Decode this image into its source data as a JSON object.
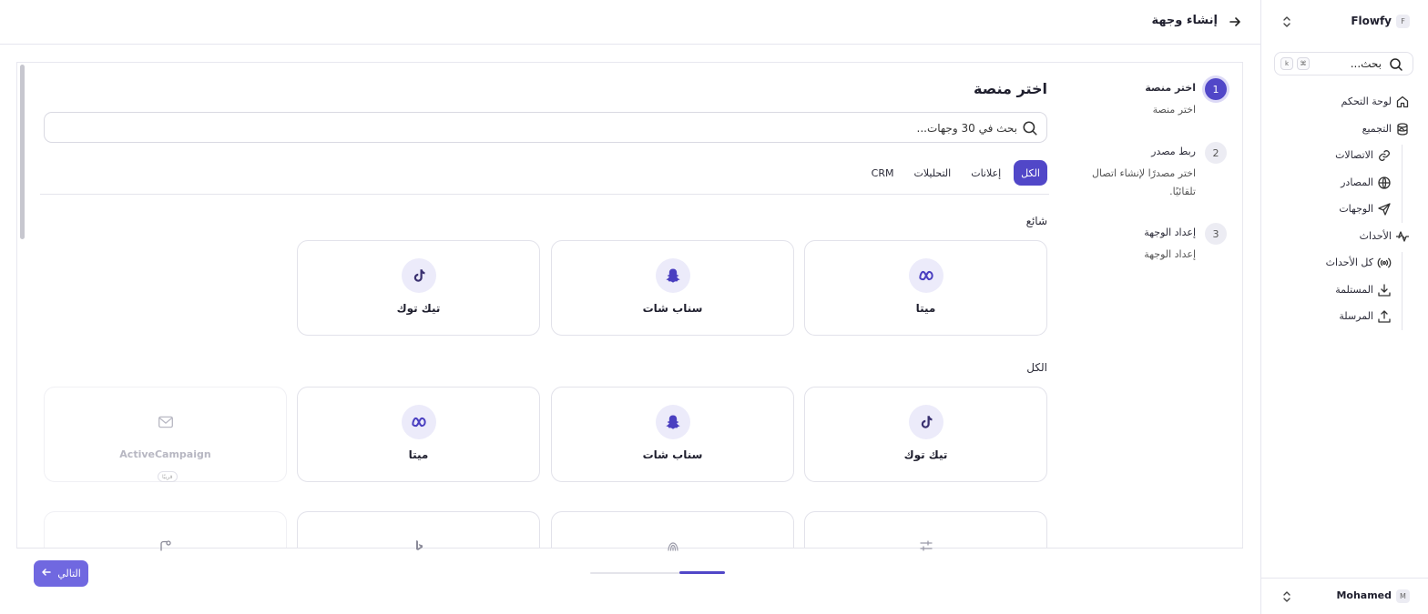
{
  "colors": {
    "accent": "#5147c8",
    "accent_soft": "#ecebfa",
    "next_button": "#7068e0"
  },
  "sidebar": {
    "workspace_name": "Flowfy",
    "workspace_badge": "F",
    "search_label": "بحث...",
    "shortcut_keys": [
      "⌘",
      "k"
    ],
    "items": [
      {
        "label": "لوحة التحكم",
        "icon": "home-icon"
      },
      {
        "label": "التجميع",
        "icon": "database-icon"
      },
      {
        "label": "الاتصالات",
        "icon": "link-icon"
      },
      {
        "label": "المصادر",
        "icon": "globe-icon"
      },
      {
        "label": "الوجهات",
        "icon": "send-icon"
      },
      {
        "label": "الأحداث",
        "icon": "activity-icon"
      },
      {
        "label": "كل الأحداث",
        "icon": "broadcast-icon"
      },
      {
        "label": "المستلمة",
        "icon": "download-icon"
      },
      {
        "label": "المرسلة",
        "icon": "upload-icon"
      }
    ],
    "user_name": "Mohamed",
    "user_badge": "M"
  },
  "header": {
    "title": "إنشاء وجهة"
  },
  "steps": [
    {
      "number": "1",
      "title": "اختر منصة",
      "description": "اختر منصة"
    },
    {
      "number": "2",
      "title": "ربط مصدر",
      "description": "اختر مصدرًا لإنشاء اتصال تلقائيًا."
    },
    {
      "number": "3",
      "title": "إعداد الوجهة",
      "description": "إعداد الوجهة"
    }
  ],
  "main": {
    "title": "اختر منصة",
    "search_placeholder": "بحث في 30 وجهات...",
    "tabs": [
      "الكل",
      "إعلانات",
      "التحليلات",
      "CRM"
    ],
    "popular_title": "شائع",
    "all_title": "الكل",
    "popular": [
      {
        "name": "ميتا",
        "icon": "meta-icon"
      },
      {
        "name": "سناب شات",
        "icon": "snapchat-icon"
      },
      {
        "name": "تيك توك",
        "icon": "tiktok-icon"
      }
    ],
    "all": [
      {
        "name": "تيك توك",
        "icon": "tiktok-icon"
      },
      {
        "name": "سناب شات",
        "icon": "snapchat-icon"
      },
      {
        "name": "ميتا",
        "icon": "meta-icon"
      },
      {
        "name": "ActiveCampaign",
        "icon": "mail-icon",
        "tag": "قريبًا"
      }
    ]
  },
  "footer": {
    "next_label": "التالي"
  }
}
